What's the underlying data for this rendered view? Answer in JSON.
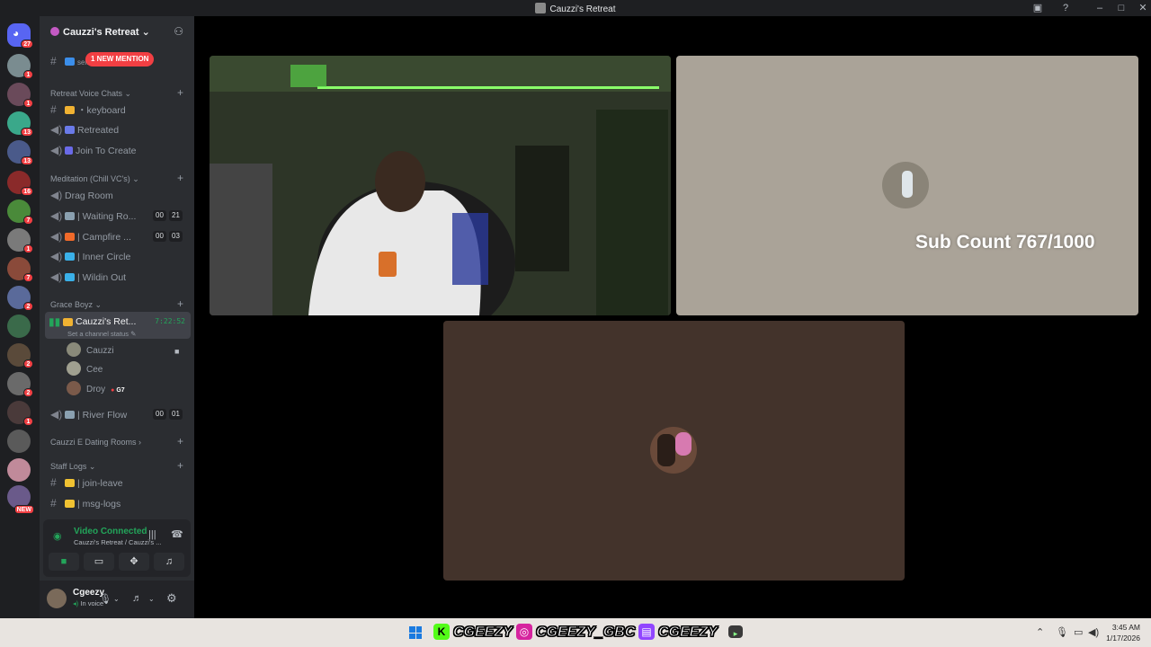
{
  "window": {
    "title": "Cauzzi's Retreat"
  },
  "guilds": {
    "home_badge": "27",
    "items": [
      {
        "color": "#7a8c90",
        "badge": "1"
      },
      {
        "color": "#6a4a5a",
        "badge": "1"
      },
      {
        "color": "#3aa88a",
        "badge": "13"
      },
      {
        "color": "#4a5a8a",
        "badge": "13"
      },
      {
        "color": "#8a2a2a",
        "badge": "16"
      },
      {
        "color": "#4a8a3a",
        "badge": "7"
      },
      {
        "color": "#7a7a7a",
        "badge": "1"
      },
      {
        "color": "#8a4a3a",
        "badge": "7"
      },
      {
        "color": "#5a6a9a",
        "badge": "2"
      },
      {
        "color": "#3a6a4a",
        "badge": ""
      },
      {
        "color": "#5a4a3a",
        "badge": "2"
      },
      {
        "color": "#6a6a6a",
        "badge": "2"
      },
      {
        "color": "#4a3a3a",
        "badge": "1"
      },
      {
        "color": "#5a5a5a",
        "badge": ""
      },
      {
        "color": "#c08a9a",
        "badge": ""
      },
      {
        "color": "#6a5a8a",
        "badge": "NEW"
      }
    ]
  },
  "sidebar": {
    "server_name": "Cauzzi's Retreat",
    "new_mention": "1 NEW MENTION",
    "top_partial_channel": "self-promotion",
    "categories": {
      "voice": "Retreat Voice Chats",
      "meditation": "Meditation (Chill VC's)",
      "grace": "Grace Boyz",
      "dating": "Cauzzi E Dating Rooms",
      "staff": "Staff Logs"
    },
    "channels": {
      "keyboard": "・keyboard",
      "retreated": "Retreated",
      "join_to_create": "Join To Create",
      "drag_room": "Drag Room",
      "waiting_room": "| Waiting Ro...",
      "waiting_count": [
        "00",
        "21"
      ],
      "campfire": "| Campfire ...",
      "campfire_count": [
        "00",
        "03"
      ],
      "inner_circle": "| Inner Circle",
      "wildin_out": "| Wildin Out",
      "cauzzis_retreat": "Cauzzi's Ret...",
      "timer": "7:22:52",
      "status": "Set a channel status",
      "river_flow": "| River Flow",
      "river_count": [
        "00",
        "01"
      ],
      "join_leave": "| join-leave",
      "msg_logs": "| msg-logs"
    },
    "voice_users": [
      {
        "name": "Cauzzi",
        "color": "#8a8a7a"
      },
      {
        "name": "Cee",
        "color": "#a0a090"
      },
      {
        "name": "Droy",
        "color": "#7a5a4a",
        "tag": "G7"
      }
    ]
  },
  "voice_panel": {
    "title": "Video Connected",
    "subtitle": "Cauzzi's Retreat / Cauzzi's ..."
  },
  "user": {
    "name": "Cgeezy",
    "status": "In voice"
  },
  "stage": {
    "sub_count": "Sub Count 767/1000"
  },
  "taskbar": {
    "kick": "CGEEZY",
    "instagram": "CGEEZY_GBC",
    "twitch": "CGEEZY",
    "time": "3:45 AM",
    "date": "1/17/2026"
  }
}
